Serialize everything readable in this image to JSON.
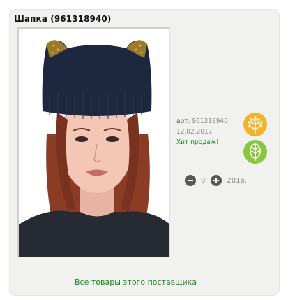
{
  "product": {
    "title": "Шапка (961318940)",
    "article_label": "арт:",
    "article_value": "961318940",
    "date": "12.02.2017",
    "hit_label": "Хит продаж!"
  },
  "cart": {
    "quantity": "0",
    "price": "201р."
  },
  "links": {
    "supplier_all": "Все товары этого поставщика"
  },
  "colors": {
    "badge_orange": "#f2b22a",
    "badge_green": "#8cc63f",
    "link_green": "#1a8a1a"
  },
  "icons": {
    "badge_orange": "maple-leaf-icon",
    "badge_green": "leaf-icon",
    "minus": "minus-circle-icon",
    "plus": "plus-circle-icon"
  }
}
